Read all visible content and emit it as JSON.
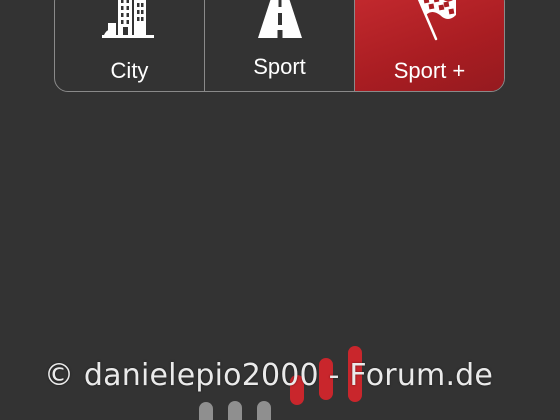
{
  "drive_modes": [
    {
      "label": "City",
      "icon": "city-buildings-icon",
      "active": false
    },
    {
      "label": "Sport",
      "icon": "road-icon",
      "active": false
    },
    {
      "label": "Sport +",
      "icon": "checkered-flag-icon",
      "active": true
    }
  ],
  "watermark": "© danielepio2000 - Forum.de",
  "colors": {
    "background": "#333333",
    "active_mode": "#b3222a",
    "border": "#8a8a8a",
    "level_active": "#c9262c",
    "level_inactive": "#8f8f8f"
  }
}
